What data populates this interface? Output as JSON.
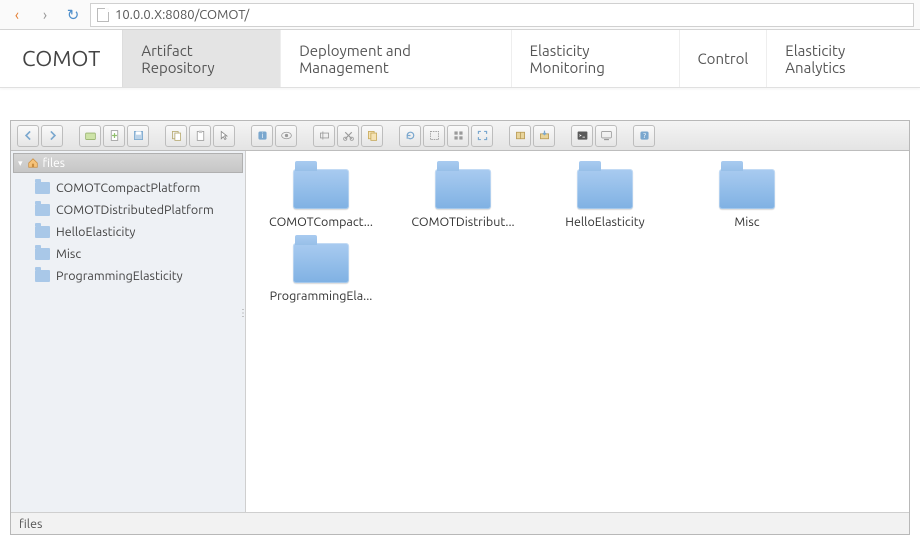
{
  "browser": {
    "url": "10.0.0.X:8080/COMOT/"
  },
  "brand": "COMOT",
  "tabs": [
    {
      "label": "Artifact Repository",
      "active": true
    },
    {
      "label": "Deployment and Management"
    },
    {
      "label": "Elasticity Monitoring"
    },
    {
      "label": "Control"
    },
    {
      "label": "Elasticity Analytics"
    }
  ],
  "tree": {
    "root": "files",
    "items": [
      "COMOTCompactPlatform",
      "COMOTDistributedPlatform",
      "HelloElasticity",
      "Misc",
      "ProgrammingElasticity"
    ]
  },
  "content": [
    {
      "label": "COMOTCompact..."
    },
    {
      "label": "COMOTDistribut..."
    },
    {
      "label": "HelloElasticity"
    },
    {
      "label": "Misc"
    },
    {
      "label": "ProgrammingEla..."
    }
  ],
  "status": "files"
}
